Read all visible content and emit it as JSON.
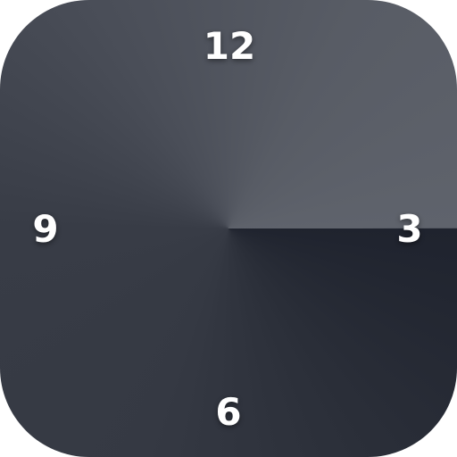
{
  "clock_face": {
    "hour_labels": {
      "twelve": "12",
      "three": "3",
      "six": "6",
      "nine": "9"
    },
    "colors": {
      "face_light": "#5f636c",
      "face_mid": "#383c46",
      "face_dark": "#1f232e",
      "numeral": "#ffffff"
    }
  }
}
